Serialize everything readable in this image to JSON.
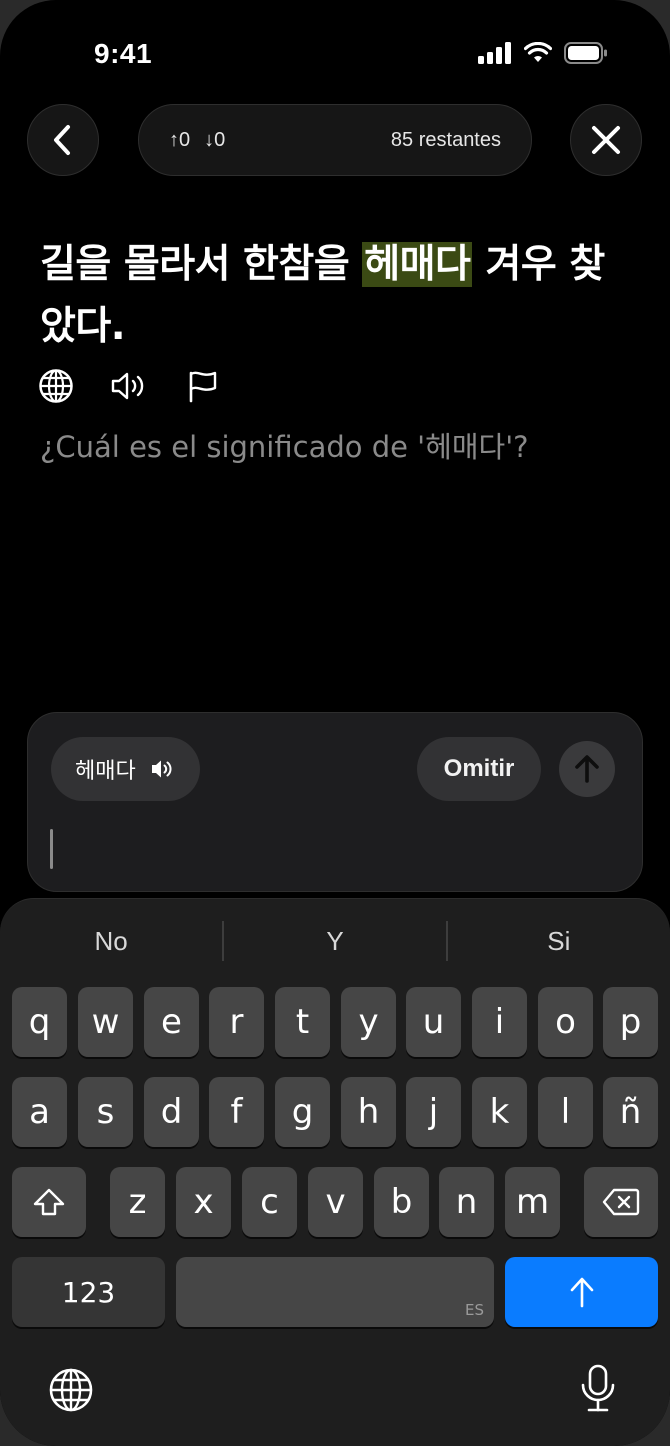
{
  "status_bar": {
    "time": "9:41"
  },
  "header": {
    "up_count": "↑0",
    "down_count": "↓0",
    "remaining": "85 restantes"
  },
  "exercise": {
    "sentence_before": "길을 몰라서 한참을 ",
    "target_word": "헤매다",
    "sentence_after": " 겨우 찾았다.",
    "question": "¿Cuál es el significado de '헤매다'?"
  },
  "answer": {
    "word_chip": "헤매다",
    "omit_label": "Omitir"
  },
  "keyboard": {
    "suggestions": [
      "No",
      "Y",
      "Si"
    ],
    "row1": [
      "q",
      "w",
      "e",
      "r",
      "t",
      "y",
      "u",
      "i",
      "o",
      "p"
    ],
    "row2": [
      "a",
      "s",
      "d",
      "f",
      "g",
      "h",
      "j",
      "k",
      "l",
      "ñ"
    ],
    "row3": [
      "z",
      "x",
      "c",
      "v",
      "b",
      "n",
      "m"
    ],
    "numbers_label": "123",
    "space_lang": "ES"
  },
  "colors": {
    "highlight": "#3b4a14",
    "return_key": "#0a7cff"
  }
}
